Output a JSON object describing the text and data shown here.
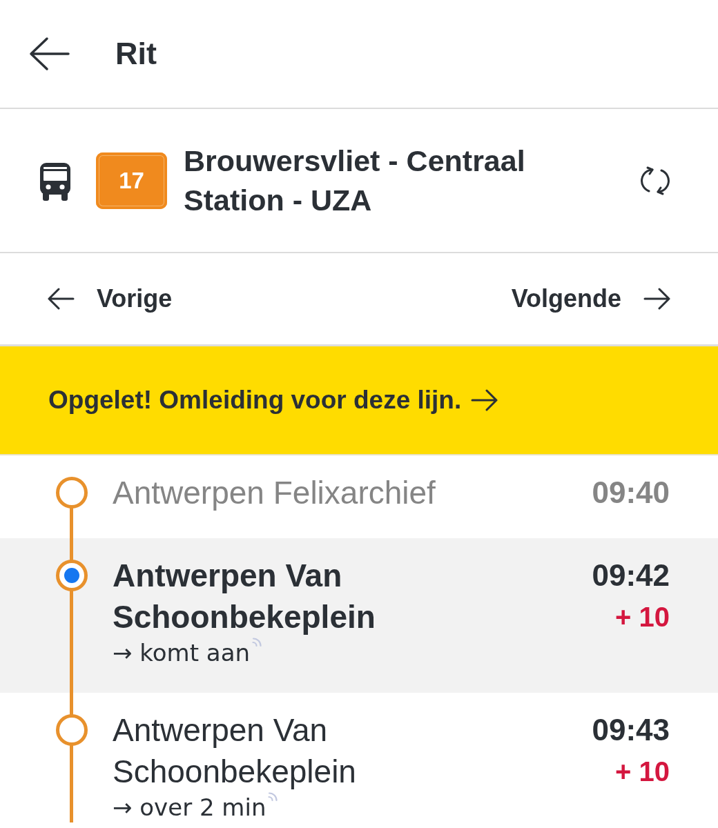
{
  "header": {
    "title": "Rit"
  },
  "route": {
    "line_number": "17",
    "name": "Brouwersvliet - Centraal Station - UZA"
  },
  "navigation": {
    "previous": "Vorige",
    "next": "Volgende"
  },
  "alert": {
    "text": "Opgelet! Omleiding voor deze lijn."
  },
  "stops": [
    {
      "name": "Antwerpen Felixarchief",
      "time": "09:40",
      "passed": true,
      "selected": false
    },
    {
      "name": "Antwerpen Van Schoonbekeplein",
      "time": "09:42",
      "delay": "+ 10",
      "passed": false,
      "selected": true,
      "note": "→ komt aan",
      "realtime": true
    },
    {
      "name": "Antwerpen Van Schoonbekeplein",
      "time": "09:43",
      "delay": "+ 10",
      "passed": false,
      "selected": false,
      "note": "→ over 2 min",
      "realtime": true
    }
  ]
}
